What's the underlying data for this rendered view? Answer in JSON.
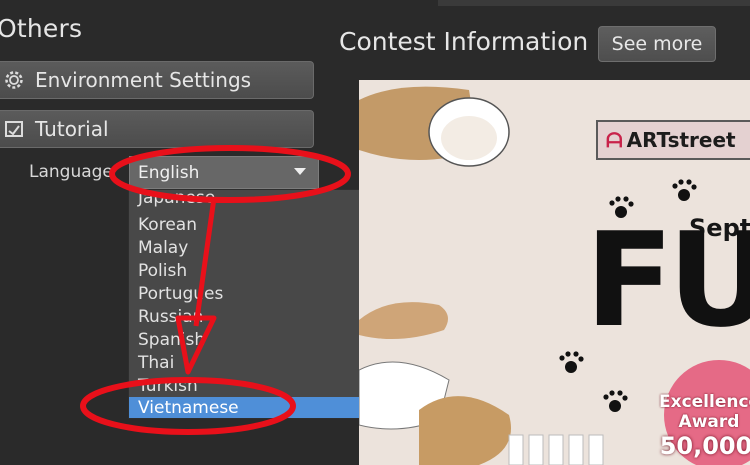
{
  "section": {
    "title": "Others"
  },
  "menu": {
    "environment_label": "Environment Settings",
    "environment_icon": "gear-icon",
    "tutorial_label": "Tutorial",
    "tutorial_icon": "tutorial-icon"
  },
  "language": {
    "label": "Language",
    "selected": "English",
    "options": [
      "Japanese",
      "Korean",
      "Malay",
      "Polish",
      "Portugues",
      "Russian",
      "Spanish",
      "Thai",
      "Turkish",
      "Vietnamese"
    ],
    "highlighted": "Vietnamese"
  },
  "contest": {
    "title": "Contest Information",
    "see_more": "See more",
    "banner": {
      "brand": "ARTstreet",
      "month": "Sept",
      "headline": "FU",
      "award_line1": "Excellence",
      "award_line2": "Award",
      "award_amount": "50,000"
    }
  },
  "colors": {
    "selection": "#4f8fd8",
    "annotation": "#e8101a",
    "panel_bg": "#2a2a2a"
  }
}
